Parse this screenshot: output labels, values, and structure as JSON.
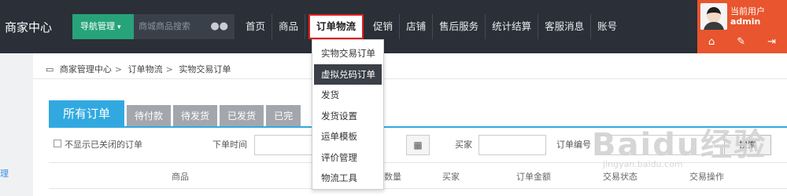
{
  "header": {
    "brand": "商家中心",
    "nav_button_label": "导航管理",
    "search_placeholder": "商城商品搜索",
    "menu": [
      "首页",
      "商品",
      "订单物流",
      "促销",
      "店铺",
      "售后服务",
      "统计结算",
      "客服消息",
      "账号"
    ],
    "active_menu_index": 2
  },
  "user": {
    "label": "当前用户",
    "name": "admin",
    "icons": [
      "home-icon",
      "wrench-icon",
      "logout-icon"
    ]
  },
  "breadcrumb": {
    "items": [
      "商家管理中心",
      "订单物流",
      "实物交易订单"
    ],
    "separator": ">"
  },
  "dropdown": {
    "items": [
      "实物交易订单",
      "虚拟兑码订单",
      "发货",
      "发货设置",
      "运单模板",
      "评价管理",
      "物流工具"
    ],
    "highlighted_index": 1
  },
  "tabs": [
    "所有订单",
    "待付款",
    "待发货",
    "已发货",
    "已完"
  ],
  "filter": {
    "hide_closed_label": "不显示已关闭的订单",
    "order_time_label": "下单时间",
    "buyer_label": "买家",
    "order_no_label": "订单编号",
    "search_button": "搜索"
  },
  "table_headers": [
    "商品",
    "数量",
    "买家",
    "订单金额",
    "交易状态",
    "交易操作"
  ],
  "watermark": {
    "text": "Baidu经验",
    "url": "jingyan.baidu.com"
  },
  "left_strip": {
    "label": "理"
  },
  "colors": {
    "topbar": "#2a2f38",
    "nav_green": "#27a37a",
    "user_orange": "#e8552e",
    "tab_blue": "#31a9e0",
    "tab_gray": "#a3a7ad",
    "active_border": "#e02020"
  }
}
